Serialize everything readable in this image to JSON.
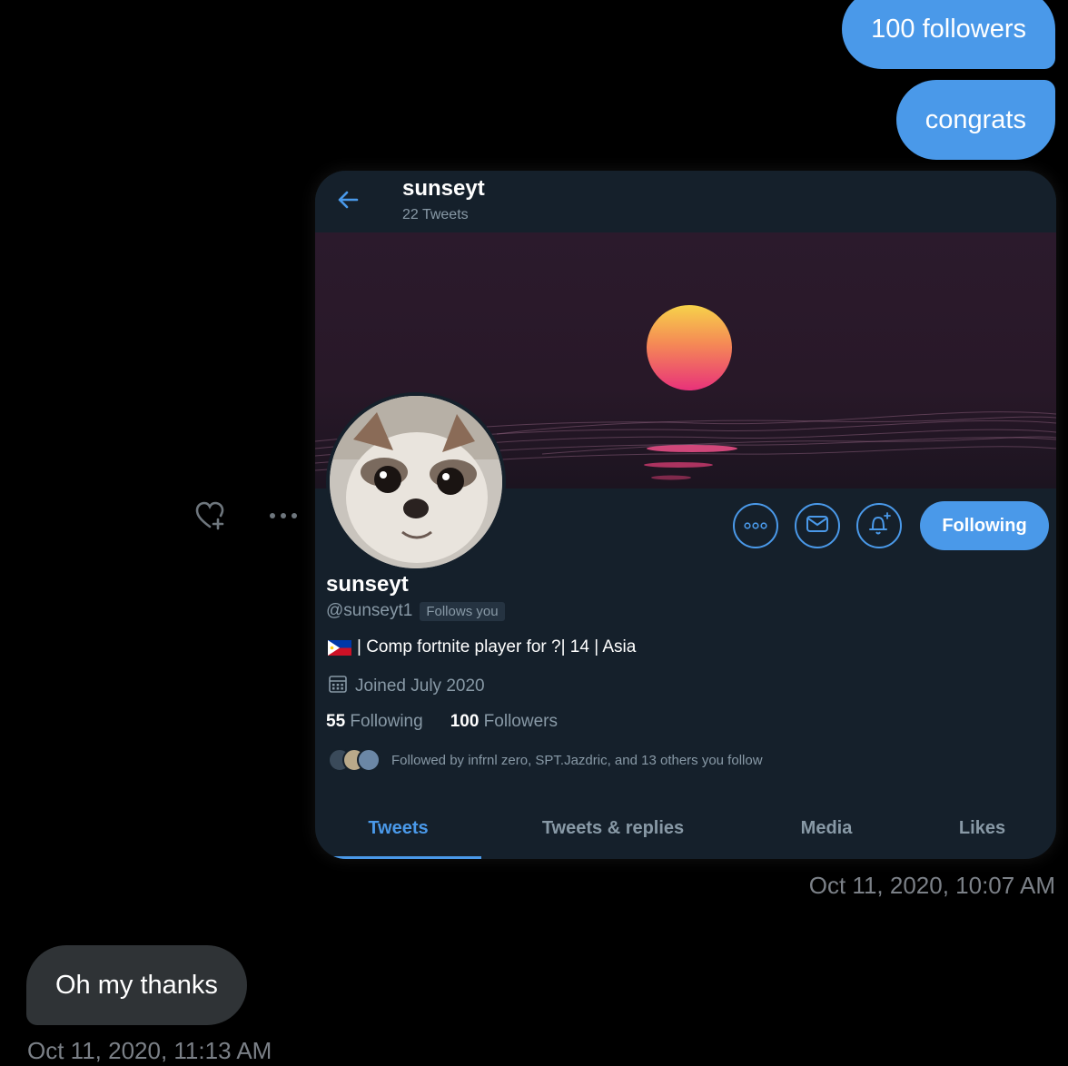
{
  "messages": {
    "sent_1": "100 followers",
    "sent_2": "congrats",
    "sent_timestamp": "Oct 11, 2020, 10:07 AM",
    "received_1": "Oh my thanks",
    "received_timestamp": "Oct 11, 2020, 11:13 AM"
  },
  "message_actions": {
    "react_icon": "heart-plus-icon",
    "more_icon": "ellipsis-icon"
  },
  "profile_card": {
    "header": {
      "back_icon": "arrow-left-icon",
      "name": "sunseyt",
      "tweet_count": "22 Tweets"
    },
    "buttons": {
      "more_icon": "more-circle-icon",
      "message_icon": "mail-icon",
      "notify_icon": "bell-plus-icon",
      "following_label": "Following"
    },
    "name": "sunseyt",
    "handle": "@sunseyt1",
    "follows_you": "Follows you",
    "bio": "| Comp fortnite player for ?| 14 | Asia",
    "joined": "Joined July 2020",
    "following_count": "55",
    "following_label": "Following",
    "followers_count": "100",
    "followers_label": "Followers",
    "followed_by": "Followed by infrnl zero, SPT.Jazdric, and 13 others you follow",
    "tabs": [
      {
        "label": "Tweets",
        "active": true
      },
      {
        "label": "Tweets & replies",
        "active": false
      },
      {
        "label": "Media",
        "active": false
      },
      {
        "label": "Likes",
        "active": false
      }
    ]
  },
  "colors": {
    "background": "#000000",
    "sent_bubble": "#4a99e9",
    "received_bubble": "#2f3336",
    "card_bg": "#15202b",
    "accent": "#4a99e9",
    "muted": "#8899a6"
  }
}
